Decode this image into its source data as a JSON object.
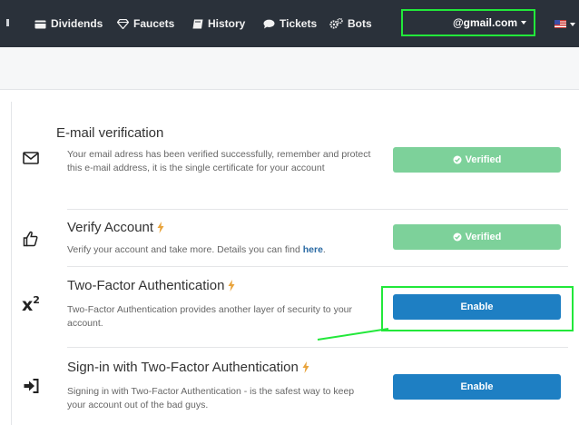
{
  "nav": {
    "items": [
      {
        "label": "Dividends",
        "icon": "wallet-icon"
      },
      {
        "label": "Faucets",
        "icon": "diamond-icon"
      },
      {
        "label": "History",
        "icon": "book-icon"
      },
      {
        "label": "Tickets",
        "icon": "chat-icon"
      },
      {
        "label": "Bots",
        "icon": "cogs-icon"
      }
    ],
    "account_email": "@gmail.com",
    "language_flag": "us-flag-icon"
  },
  "security": {
    "rows": [
      {
        "title": "E-mail verification",
        "description": "Your email adress has been verified successfully, remember and protect this e-mail address, it is the single certificate for your account",
        "button_label": "Verified",
        "icon": "envelope-icon"
      },
      {
        "title": "Verify Account",
        "description_prefix": "Verify your account and take more. Details you can find ",
        "description_link": "here",
        "description_suffix": ".",
        "button_label": "Verified",
        "icon": "thumbs-up-icon"
      },
      {
        "title": "Two-Factor Authentication",
        "description": "Two-Factor Authentication provides another layer of security to your account.",
        "button_label": "Enable",
        "icon": "superscript-icon"
      },
      {
        "title": "Sign-in with Two-Factor Authentication",
        "description": "Signing in with Two-Factor Authentication - is the safest way to keep your account out of the bad guys.",
        "button_label": "Enable",
        "icon": "sign-in-icon"
      }
    ]
  },
  "colors": {
    "navbar": "#2a313a",
    "verified": "#7dd19a",
    "enable": "#1e7fc3",
    "highlight": "#22e83a",
    "bolt": "#e8a33b"
  }
}
